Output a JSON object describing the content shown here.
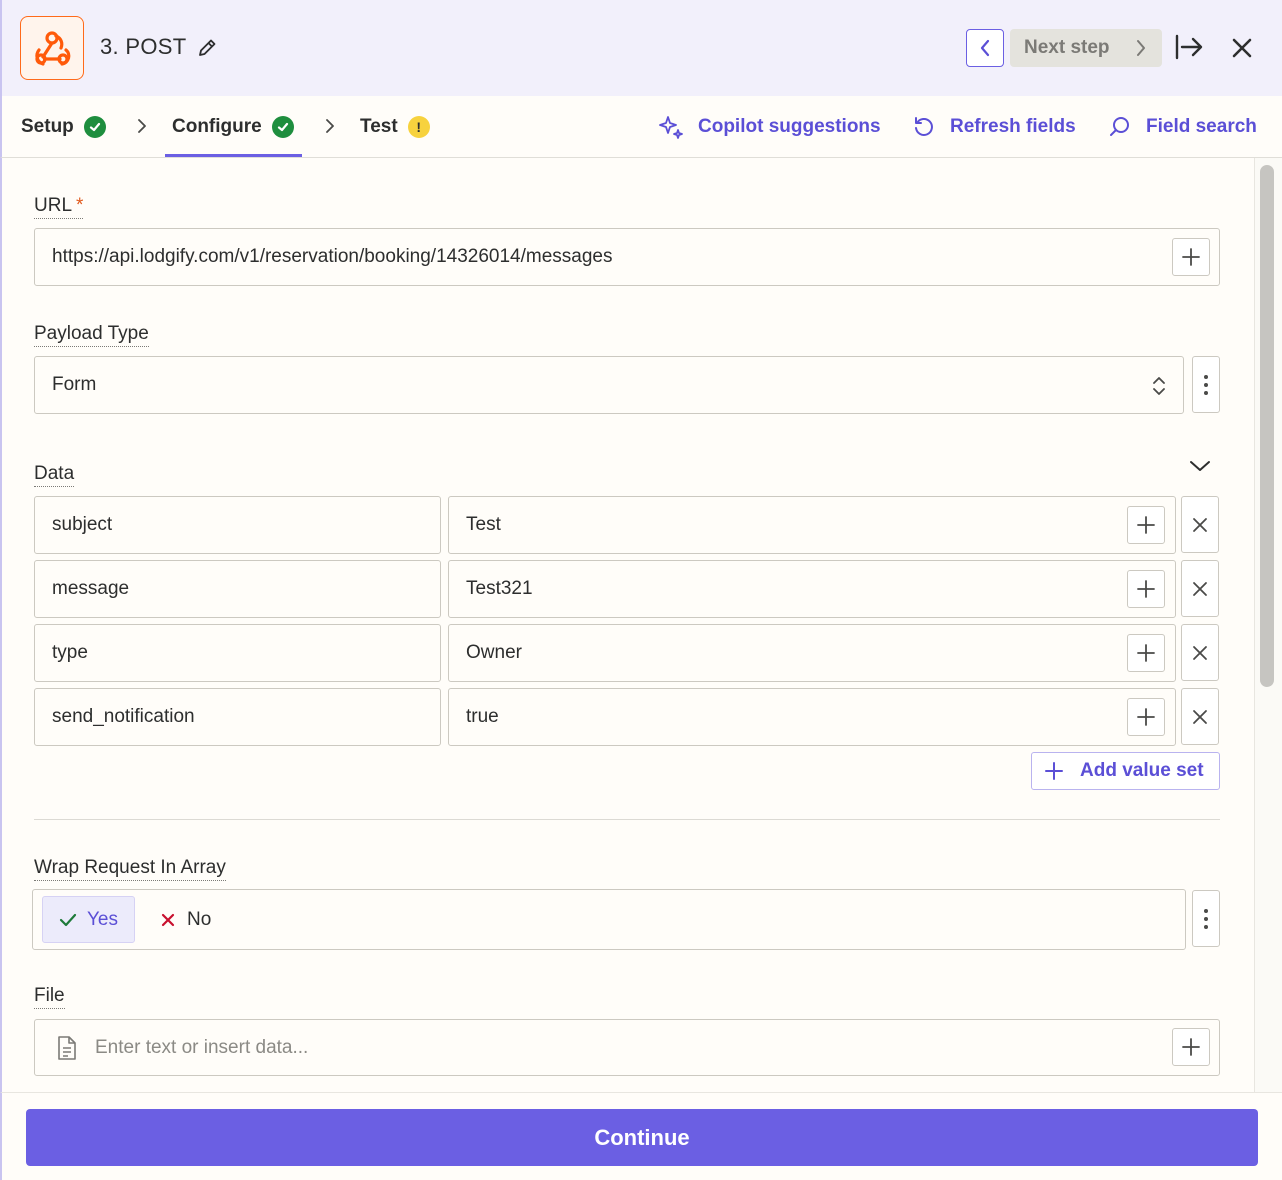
{
  "header": {
    "title": "3. POST",
    "next_step_label": "Next step"
  },
  "tabs": [
    {
      "label": "Setup",
      "status": "complete"
    },
    {
      "label": "Configure",
      "status": "complete",
      "active": true
    },
    {
      "label": "Test",
      "status": "warning",
      "status_glyph": "!"
    }
  ],
  "toolbar": {
    "copilot_label": "Copilot suggestions",
    "refresh_label": "Refresh fields",
    "search_label": "Field search"
  },
  "form": {
    "url": {
      "label": "URL",
      "required_mark": "*",
      "value": "https://api.lodgify.com/v1/reservation/booking/14326014/messages"
    },
    "payload_type": {
      "label": "Payload Type",
      "value": "Form"
    },
    "data": {
      "label": "Data",
      "rows": [
        {
          "key": "subject",
          "value": "Test"
        },
        {
          "key": "message",
          "value": "Test321"
        },
        {
          "key": "type",
          "value": "Owner"
        },
        {
          "key": "send_notification",
          "value": "true"
        }
      ],
      "add_label": "Add value set"
    },
    "wrap_request": {
      "label": "Wrap Request In Array",
      "yes_label": "Yes",
      "no_label": "No",
      "selected": "Yes"
    },
    "file": {
      "label": "File",
      "placeholder": "Enter text or insert data..."
    }
  },
  "footer": {
    "continue_label": "Continue"
  },
  "colors": {
    "accent": "#6b5fe3",
    "success": "#1e8e3e",
    "warning": "#f7d23e",
    "brand_orange": "#ff6a1a"
  }
}
